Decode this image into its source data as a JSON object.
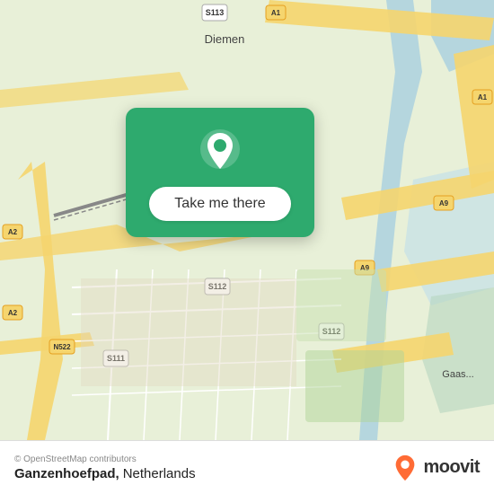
{
  "map": {
    "background_color": "#e8f0d8",
    "alt": "OpenStreetMap showing Ganzenhoefpad area in Amsterdam Netherlands"
  },
  "card": {
    "button_label": "Take me there",
    "background_color": "#2eaa6e"
  },
  "bottom_bar": {
    "copyright": "© OpenStreetMap contributors",
    "location_name": "Ganzenhoefpad,",
    "location_country": "Netherlands",
    "moovit_label": "moovit"
  }
}
